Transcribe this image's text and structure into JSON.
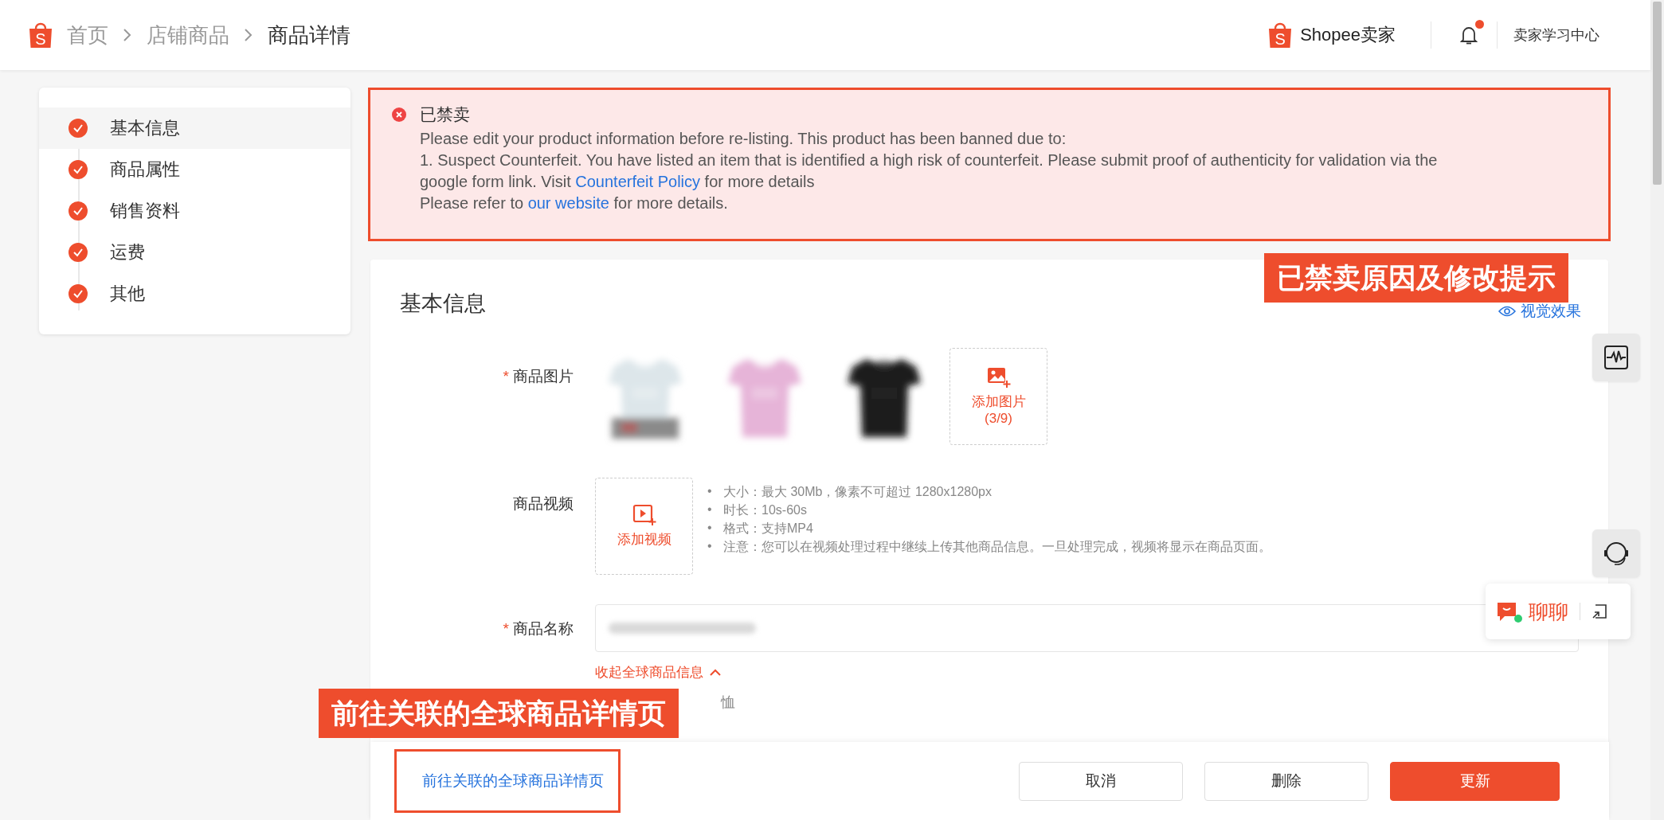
{
  "header": {
    "logo_letter": "S",
    "breadcrumb": [
      {
        "label": "首页",
        "current": false
      },
      {
        "label": "店铺商品",
        "current": false
      },
      {
        "label": "商品详情",
        "current": true
      }
    ],
    "brand_letter": "S",
    "brand": "Shopee卖家",
    "notification": true,
    "learning_center": "卖家学习中心"
  },
  "sidebar": {
    "items": [
      {
        "label": "基本信息",
        "selected": true,
        "completed": true
      },
      {
        "label": "商品属性",
        "selected": false,
        "completed": true
      },
      {
        "label": "销售资料",
        "selected": false,
        "completed": true
      },
      {
        "label": "运费",
        "selected": false,
        "completed": true
      },
      {
        "label": "其他",
        "selected": false,
        "completed": true
      }
    ]
  },
  "alert": {
    "highlighted": true,
    "title": "已禁卖",
    "paragraphs": [
      [
        {
          "text": "Please edit your product information before re-listing. This product has been banned due to:"
        }
      ],
      [
        {
          "text": "1. Suspect Counterfeit. You have listed an item that is identified a high risk of counterfeit. Please submit proof of authenticity for validation via the google form link. Visit "
        },
        {
          "text": "Counterfeit Policy",
          "kind": "link"
        },
        {
          "text": " for more details"
        }
      ],
      [
        {
          "text": "Please refer to "
        },
        {
          "text": "our website",
          "kind": "link"
        },
        {
          "text": " for more details."
        }
      ]
    ]
  },
  "form": {
    "title": "基本信息",
    "preview_link": "视觉效果",
    "fields": [
      {
        "kind": "images",
        "required_mark": "*",
        "label": "商品图片",
        "add_label": "添加图片",
        "add_count": "(3/9)"
      },
      {
        "kind": "video",
        "label": "商品视频",
        "add_label": "添加视频",
        "notes": [
          {
            "bullet": "•",
            "text": "大小：最大 30Mb，像素不可超过 1280x1280px"
          },
          {
            "bullet": "•",
            "text": "时长：10s-60s"
          },
          {
            "bullet": "•",
            "text": "格式：支持MP4"
          },
          {
            "bullet": "•",
            "text": "注意：您可以在视频处理过程中继续上传其他商品信息。一旦处理完成，视频将显示在商品页面。"
          }
        ]
      },
      {
        "kind": "text",
        "required_mark": "*",
        "label": "商品名称"
      }
    ],
    "collapse_link": "收起全球商品信息",
    "partial_text": "恤"
  },
  "footer": {
    "link": "前往关联的全球商品详情页",
    "link_highlighted": true,
    "buttons": [
      {
        "label": "取消",
        "kind": "default"
      },
      {
        "label": "删除",
        "kind": "default"
      },
      {
        "label": "更新",
        "kind": "primary"
      }
    ]
  },
  "chat": {
    "label": "聊聊",
    "online": true
  },
  "annotations": [
    {
      "text": "已禁卖原因及修改提示"
    },
    {
      "text": "前往关联的全球商品详情页"
    }
  ]
}
